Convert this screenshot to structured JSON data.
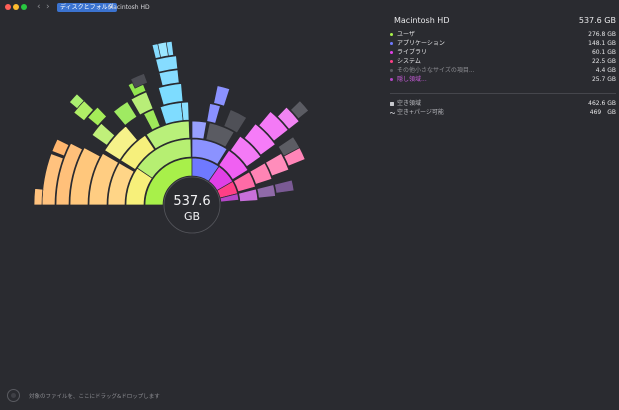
{
  "window": {
    "traffic_lights": [
      "#ff5f57",
      "#febc2e",
      "#28c840"
    ],
    "back_label": "‹",
    "forward_label": "›"
  },
  "breadcrumb": [
    {
      "label": "ディスクとフォルダ",
      "active": true
    },
    {
      "label": "Macintosh HD",
      "active": false
    }
  ],
  "center": {
    "value": "537.6",
    "unit": "GB"
  },
  "panel": {
    "title": "Macintosh HD",
    "total": "537.6 GB",
    "items": [
      {
        "label": "ユーザ",
        "value": "276.8 GB",
        "color": "#a8f04a",
        "text_color": "#e6e6e8"
      },
      {
        "label": "アプリケーション",
        "value": "148.1 GB",
        "color": "#6f79ff",
        "text_color": "#e6e6e8"
      },
      {
        "label": "ライブラリ",
        "value": "60.1 GB",
        "color": "#e040e6",
        "text_color": "#e6e6e8"
      },
      {
        "label": "システム",
        "value": "22.5 GB",
        "color": "#ff3f86",
        "text_color": "#e6e6e8"
      },
      {
        "label": "その他小さなサイズの項目...",
        "value": "4.4 GB",
        "color": "#5c5d63",
        "text_color": "#8c8d92"
      },
      {
        "label": "隠し領域...",
        "value": "25.7 GB",
        "color": "#b547c8",
        "text_color": "#c65bd8"
      }
    ],
    "free": [
      {
        "label": "空き領域",
        "value": "462.6 GB",
        "icon": "square-icon"
      },
      {
        "label": "空き+パージ可能",
        "value": "469　GB",
        "icon": "tilde-icon"
      }
    ]
  },
  "drop_hint": "対象のファイルを、ここにドラッグ&ドロップします"
}
